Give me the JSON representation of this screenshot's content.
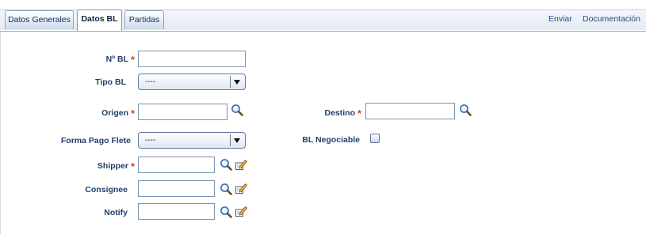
{
  "tabs": [
    {
      "label": "Datos Generales"
    },
    {
      "label": "Datos BL"
    },
    {
      "label": "Partidas"
    }
  ],
  "active_tab": "Datos BL",
  "actions": {
    "enviar": "Enviar",
    "documentacion": "Documentación"
  },
  "form": {
    "nro_bl": {
      "label": "Nº BL",
      "required": true,
      "value": ""
    },
    "tipo_bl": {
      "label": "Tipo BL",
      "selected": "----"
    },
    "origen": {
      "label": "Origen",
      "required": true,
      "value": ""
    },
    "destino": {
      "label": "Destino",
      "required": true,
      "value": ""
    },
    "forma_pago_flete": {
      "label": "Forma Pago Flete",
      "selected": "----"
    },
    "bl_negociable": {
      "label": "BL Negociable",
      "checked": false
    },
    "shipper": {
      "label": "Shipper",
      "required": true,
      "value": ""
    },
    "consignee": {
      "label": "Consignee",
      "value": ""
    },
    "notify": {
      "label": "Notify",
      "value": ""
    }
  },
  "required_marker": "*",
  "icons": {
    "search": "search-icon",
    "edit": "edit-icon"
  },
  "colors": {
    "label": "#1f3f6b",
    "required": "#e0412b",
    "tab_text": "#15305a"
  }
}
